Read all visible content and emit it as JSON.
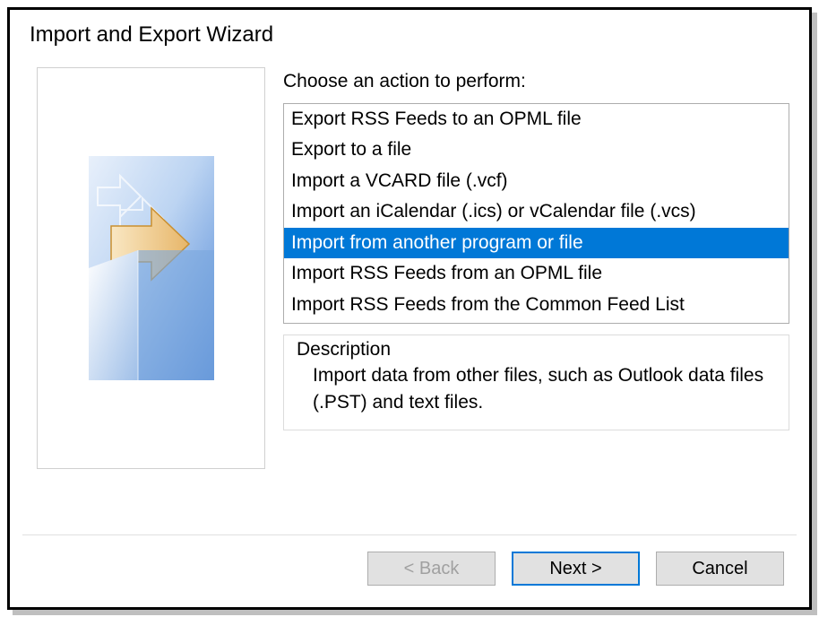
{
  "title": "Import and Export Wizard",
  "prompt": "Choose an action to perform:",
  "actions": [
    {
      "label": "Export RSS Feeds to an OPML file",
      "selected": false
    },
    {
      "label": "Export to a file",
      "selected": false
    },
    {
      "label": "Import a VCARD file (.vcf)",
      "selected": false
    },
    {
      "label": "Import an iCalendar (.ics) or vCalendar file (.vcs)",
      "selected": false
    },
    {
      "label": "Import from another program or file",
      "selected": true
    },
    {
      "label": "Import RSS Feeds from an OPML file",
      "selected": false
    },
    {
      "label": "Import RSS Feeds from the Common Feed List",
      "selected": false
    }
  ],
  "description": {
    "legend": "Description",
    "text": "Import data from other files, such as Outlook data files (.PST) and text files."
  },
  "buttons": {
    "back": "< Back",
    "next": "Next >",
    "cancel": "Cancel"
  }
}
